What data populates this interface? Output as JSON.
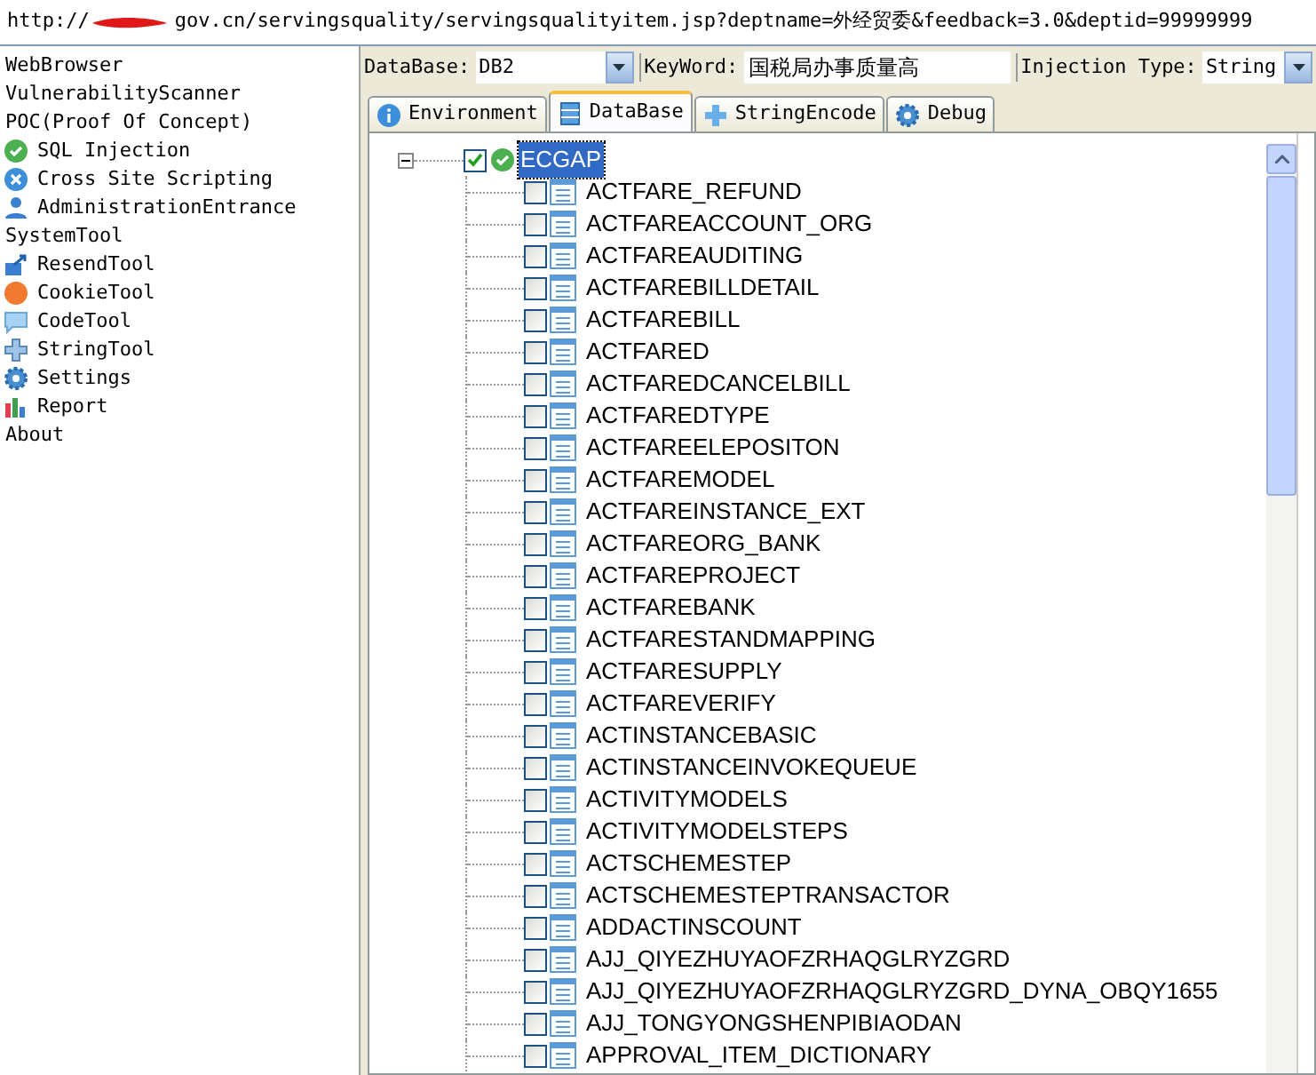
{
  "address_bar": {
    "scheme": "http://",
    "rest": "gov.cn/servingsquality/servingsqualityitem.jsp?deptname=外经贸委&feedback=3.0&deptid=99999999"
  },
  "sidebar": {
    "items": [
      {
        "label": "WebBrowser",
        "kind": "group"
      },
      {
        "label": "VulnerabilityScanner",
        "kind": "group"
      },
      {
        "label": "POC(Proof Of Concept)",
        "kind": "group"
      },
      {
        "label": "SQL Injection",
        "kind": "tool"
      },
      {
        "label": "Cross Site Scripting",
        "kind": "tool"
      },
      {
        "label": "AdministrationEntrance",
        "kind": "tool"
      },
      {
        "label": "SystemTool",
        "kind": "group"
      },
      {
        "label": "ResendTool",
        "kind": "tool"
      },
      {
        "label": "CookieTool",
        "kind": "tool"
      },
      {
        "label": "CodeTool",
        "kind": "tool"
      },
      {
        "label": "StringTool",
        "kind": "tool"
      },
      {
        "label": "Settings",
        "kind": "tool"
      },
      {
        "label": "Report",
        "kind": "tool"
      },
      {
        "label": "About",
        "kind": "group"
      }
    ]
  },
  "toolbar": {
    "database": {
      "label": "DataBase:",
      "value": "DB2"
    },
    "keyword": {
      "label": "KeyWord:",
      "value": "国税局办事质量高"
    },
    "injection_type": {
      "label": "Injection Type:",
      "value": "String"
    }
  },
  "tabs": [
    {
      "label": "Environment",
      "selected": false
    },
    {
      "label": "DataBase",
      "selected": true
    },
    {
      "label": "StringEncode",
      "selected": false
    },
    {
      "label": "Debug",
      "selected": false
    }
  ],
  "tree": {
    "root": {
      "label": "ECGAP",
      "checked": true,
      "expanded": true,
      "selected": true,
      "children": [
        {
          "label": "ACTFARE_REFUND",
          "checked": false
        },
        {
          "label": "ACTFAREACCOUNT_ORG",
          "checked": false
        },
        {
          "label": "ACTFAREAUDITING",
          "checked": false
        },
        {
          "label": "ACTFAREBILLDETAIL",
          "checked": false
        },
        {
          "label": "ACTFAREBILL",
          "checked": false
        },
        {
          "label": "ACTFARED",
          "checked": false
        },
        {
          "label": "ACTFAREDCANCELBILL",
          "checked": false
        },
        {
          "label": "ACTFAREDTYPE",
          "checked": false
        },
        {
          "label": "ACTFAREELEPOSITON",
          "checked": false
        },
        {
          "label": "ACTFAREMODEL",
          "checked": false
        },
        {
          "label": "ACTFAREINSTANCE_EXT",
          "checked": false
        },
        {
          "label": "ACTFAREORG_BANK",
          "checked": false
        },
        {
          "label": "ACTFAREPROJECT",
          "checked": false
        },
        {
          "label": "ACTFAREBANK",
          "checked": false
        },
        {
          "label": "ACTFARESTANDMAPPING",
          "checked": false
        },
        {
          "label": "ACTFARESUPPLY",
          "checked": false
        },
        {
          "label": "ACTFAREVERIFY",
          "checked": false
        },
        {
          "label": "ACTINSTANCEBASIC",
          "checked": false
        },
        {
          "label": "ACTINSTANCEINVOKEQUEUE",
          "checked": false
        },
        {
          "label": "ACTIVITYMODELS",
          "checked": false
        },
        {
          "label": "ACTIVITYMODELSTEPS",
          "checked": false
        },
        {
          "label": "ACTSCHEMESTEP",
          "checked": false
        },
        {
          "label": "ACTSCHEMESTEPTRANSACTOR",
          "checked": false
        },
        {
          "label": "ADDACTINSCOUNT",
          "checked": false
        },
        {
          "label": "AJJ_QIYEZHUYAOFZRHAQGLRYZGRD",
          "checked": false
        },
        {
          "label": "AJJ_QIYEZHUYAOFZRHAQGLRYZGRD_DYNA_OBQY1655",
          "checked": false
        },
        {
          "label": "AJJ_TONGYONGSHENPIBIAODAN",
          "checked": false
        },
        {
          "label": "APPROVAL_ITEM_DICTIONARY",
          "checked": false
        }
      ]
    }
  }
}
